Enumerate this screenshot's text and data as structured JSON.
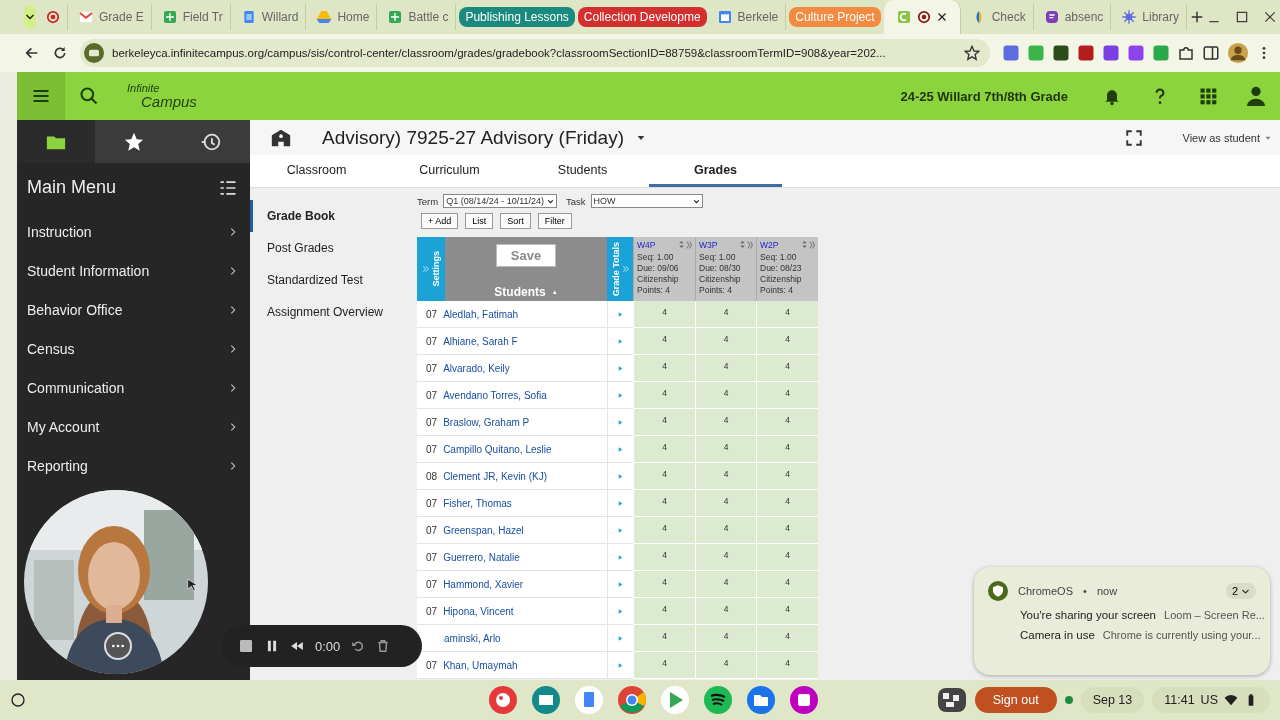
{
  "browser_tabs": [
    {
      "kind": "record",
      "selected": false
    },
    {
      "kind": "tab",
      "title": "Grade E",
      "selected": false
    },
    {
      "kind": "tab",
      "title": "Field Tr",
      "selected": false
    },
    {
      "kind": "tab",
      "title": "Willard",
      "selected": false
    },
    {
      "kind": "tab",
      "title": "Home",
      "selected": false
    },
    {
      "kind": "tab",
      "title": "Battle c",
      "selected": false
    },
    {
      "kind": "group",
      "title": "Publishing Lessons",
      "color": "#1b8a7e"
    },
    {
      "kind": "group",
      "title": "Collection Developme",
      "color": "#d32f2f"
    },
    {
      "kind": "tab",
      "title": "Berkele",
      "selected": false
    },
    {
      "kind": "group",
      "title": "Culture Project",
      "color": "#f28b40"
    },
    {
      "kind": "tab",
      "selected": true
    },
    {
      "kind": "tab",
      "title": "Check",
      "selected": false
    },
    {
      "kind": "tab",
      "title": "absenc",
      "selected": false
    },
    {
      "kind": "tab",
      "title": "Library",
      "selected": false
    }
  ],
  "address_bar": {
    "url": "berkeleyca.infinitecampus.org/campus/sis/control-center/classroom/grades/gradebook?classroomSectionID=88759&classroomTermID=908&year=202..."
  },
  "app_bar": {
    "logo_line_1": "Infinite",
    "logo_line_2": "Campus",
    "school": "24-25 Willard 7th/8th Grade"
  },
  "sidebar": {
    "tools": [
      {
        "selected": true
      },
      {
        "selected": false
      },
      {
        "selected": false
      }
    ],
    "title": "Main Menu",
    "items": [
      "Instruction",
      "Student Information",
      "Behavior Office",
      "Census",
      "Communication",
      "My Account",
      "Reporting"
    ]
  },
  "page": {
    "title": "Advisory) 7925-27 Advisory (Friday)",
    "view_as": "View as student"
  },
  "tabs": [
    {
      "label": "Classroom",
      "selected": false
    },
    {
      "label": "Curriculum",
      "selected": false
    },
    {
      "label": "Students",
      "selected": false
    },
    {
      "label": "Grades",
      "selected": true
    }
  ],
  "subnav": [
    {
      "label": "Grade Book",
      "selected": true
    },
    {
      "label": "Post Grades",
      "selected": false
    },
    {
      "label": "Standardized Test",
      "selected": false
    },
    {
      "label": "Assignment Overview",
      "selected": false
    }
  ],
  "gradebook": {
    "term_label": "Term",
    "term": "Q1 (08/14/24 - 10/11/24)",
    "task_label": "Task",
    "task": "HOW",
    "buttons": [
      "+ Add",
      "List",
      "Sort",
      "Filter"
    ],
    "settings": "Settings",
    "save": "Save",
    "students": "Students",
    "sort_arrow": "▲",
    "grade_totals": "Grade Totals",
    "assignments": [
      {
        "name": "W4P",
        "lines": [
          "Seq: 1.00",
          "Due: 09/06",
          "Citizenship",
          "Points: 4"
        ]
      },
      {
        "name": "W3P",
        "lines": [
          "Seq: 1.00",
          "Due: 08/30",
          "Citizenship",
          "Points: 4"
        ]
      },
      {
        "name": "W2P",
        "lines": [
          "Seq: 1.00",
          "Due: 08/23",
          "Citizenship",
          "Points: 4"
        ]
      }
    ],
    "rows": [
      {
        "grade": "07",
        "name": "Aledlah, Fatimah",
        "scores": [
          "4",
          "4",
          "4"
        ]
      },
      {
        "grade": "07",
        "name": "Alhiane, Sarah F",
        "scores": [
          "4",
          "4",
          "4"
        ]
      },
      {
        "grade": "07",
        "name": "Alvarado, Keily",
        "scores": [
          "4",
          "4",
          "4"
        ]
      },
      {
        "grade": "07",
        "name": "Avendano Torres, Sofia",
        "scores": [
          "4",
          "4",
          "4"
        ]
      },
      {
        "grade": "07",
        "name": "Braslow, Graham P",
        "scores": [
          "4",
          "4",
          "4"
        ]
      },
      {
        "grade": "07",
        "name": "Campillo Quitano, Leslie",
        "scores": [
          "4",
          "4",
          "4"
        ]
      },
      {
        "grade": "08",
        "name": "Clement JR, Kevin (KJ)",
        "scores": [
          "4",
          "4",
          "4"
        ]
      },
      {
        "grade": "07",
        "name": "Fisher, Thomas",
        "scores": [
          "4",
          "4",
          "4"
        ]
      },
      {
        "grade": "07",
        "name": "Greenspan, Hazel",
        "scores": [
          "4",
          "4",
          "4"
        ]
      },
      {
        "grade": "07",
        "name": "Guerrero, Natalie",
        "scores": [
          "4",
          "4",
          "4"
        ]
      },
      {
        "grade": "07",
        "name": "Hammond, Xavier",
        "scores": [
          "4",
          "4",
          "4"
        ]
      },
      {
        "grade": "07",
        "name": "Hipona, Vincent",
        "scores": [
          "4",
          "4",
          "4"
        ]
      },
      {
        "name": "aminski, Arlo",
        "scores": [
          "4",
          "4",
          "4"
        ]
      },
      {
        "grade": "07",
        "name": "Khan, Umaymah",
        "scores": [
          "4",
          "4",
          "4"
        ]
      }
    ]
  },
  "recorder": {
    "time": "0:00"
  },
  "notification": {
    "source": "ChromeOS",
    "separator": "•",
    "when": "now",
    "count": "2",
    "lines": [
      {
        "title": "You're sharing your screen",
        "text": "Loom – Screen Re..."
      },
      {
        "title": "Camera in use",
        "text": "Chrome is currently using your..."
      }
    ]
  },
  "shelf": {
    "sign_out": "Sign out",
    "date": "Sep 13",
    "time": "11:41",
    "locale": "US"
  }
}
